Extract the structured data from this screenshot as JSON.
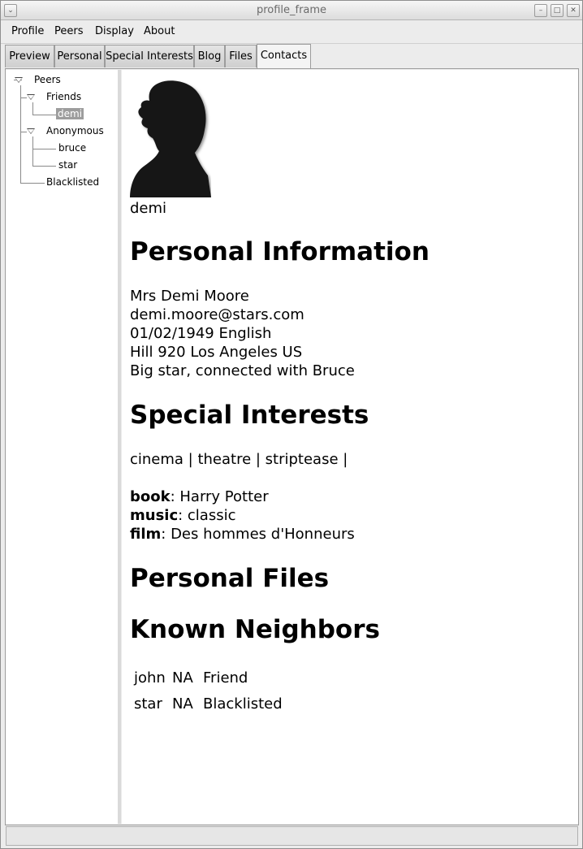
{
  "window": {
    "title": "profile_frame"
  },
  "menu": [
    "Profile",
    "Peers",
    "Display",
    "About"
  ],
  "tabs": [
    "Preview",
    "Personal",
    "Special Interests",
    "Blog",
    "Files",
    "Contacts"
  ],
  "active_tab": "Contacts",
  "tree": {
    "root": "Peers",
    "friends": "Friends",
    "friend_items": [
      "demi"
    ],
    "anonymous": "Anonymous",
    "anonymous_items": [
      "bruce",
      "star"
    ],
    "blacklisted": "Blacklisted",
    "selected": "demi"
  },
  "profile": {
    "name": "demi",
    "personal_heading": "Personal Information",
    "personal_lines": [
      "Mrs Demi Moore",
      "demi.moore@stars.com",
      "01/02/1949 English",
      "Hill 920 Los Angeles US",
      "Big star, connected with Bruce"
    ],
    "interests_heading": "Special Interests",
    "interests_line": "cinema | theatre | striptease |",
    "favorites": [
      {
        "key": "book",
        "value": ": Harry Potter"
      },
      {
        "key": "music",
        "value": ": classic"
      },
      {
        "key": "film",
        "value": ": Des hommes d'Honneurs"
      }
    ],
    "files_heading": "Personal Files",
    "neighbors_heading": "Known Neighbors",
    "neighbors": [
      {
        "name": "john",
        "status": "NA",
        "relation": "Friend"
      },
      {
        "name": "star",
        "status": "NA",
        "relation": "Blacklisted"
      }
    ]
  }
}
